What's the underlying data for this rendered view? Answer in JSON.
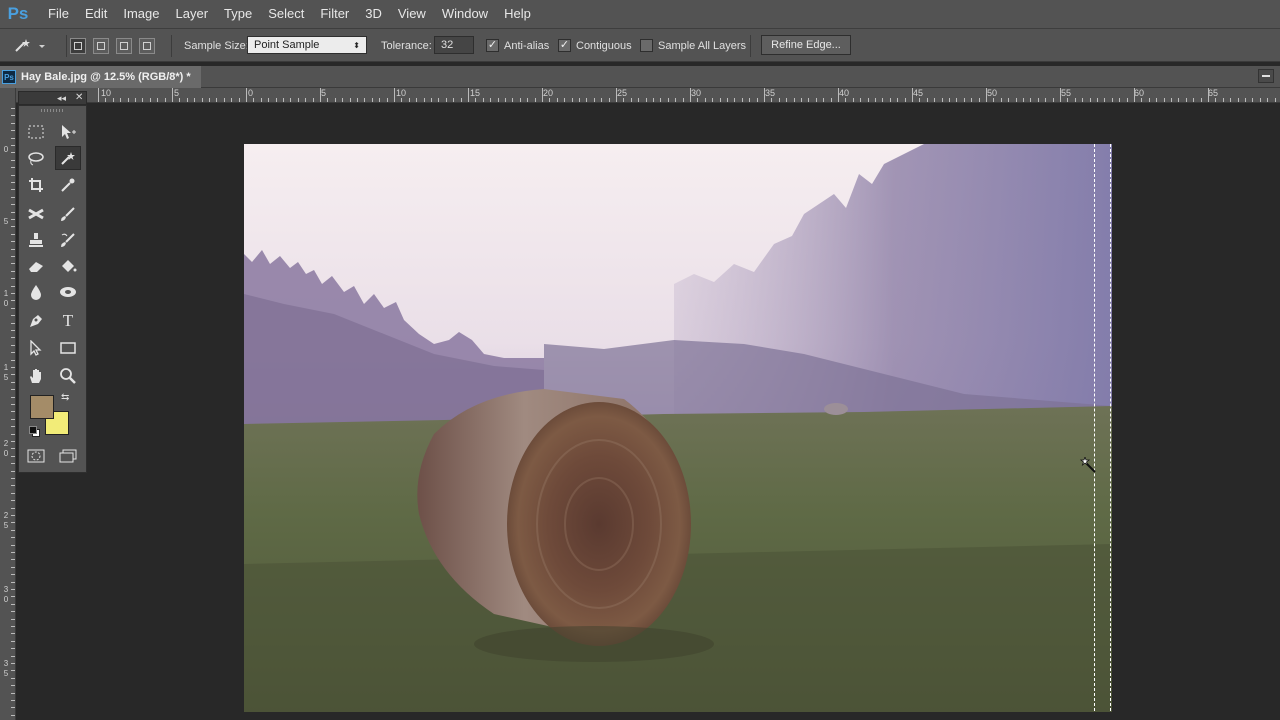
{
  "app": {
    "logo": "Ps"
  },
  "menu": [
    "File",
    "Edit",
    "Image",
    "Layer",
    "Type",
    "Select",
    "Filter",
    "3D",
    "View",
    "Window",
    "Help"
  ],
  "options_bar": {
    "tool_icon": "magic-wand-icon",
    "sample_size_label": "Sample Size:",
    "sample_size_value": "Point Sample",
    "tolerance_label": "Tolerance:",
    "tolerance_value": "32",
    "anti_alias": {
      "label": "Anti-alias",
      "checked": true
    },
    "contiguous": {
      "label": "Contiguous",
      "checked": true
    },
    "sample_all_layers": {
      "label": "Sample All Layers",
      "checked": false
    },
    "refine_edge": "Refine Edge..."
  },
  "document": {
    "tab_title": "Hay Bale.jpg @ 12.5% (RGB/8*) *",
    "ps_badge": "Ps"
  },
  "ruler_top": {
    "labels": [
      "10",
      "5",
      "0",
      "5",
      "10",
      "15",
      "20",
      "25",
      "30",
      "35",
      "40",
      "45",
      "50",
      "55",
      "60",
      "65"
    ],
    "origin_label": "0"
  },
  "ruler_left": {
    "labels": [
      "0",
      "5",
      "1",
      "0",
      "1",
      "5",
      "2",
      "0",
      "2",
      "5",
      "3",
      "0",
      "3",
      "5"
    ]
  },
  "toolbar": {
    "tools": [
      "rectangular-marquee-icon",
      "move-icon",
      "lasso-icon",
      "magic-wand-icon",
      "crop-icon",
      "eyedropper-icon",
      "healing-brush-icon",
      "brush-icon",
      "clone-stamp-icon",
      "history-brush-icon",
      "eraser-icon",
      "paint-bucket-icon",
      "blur-icon",
      "dodge-icon",
      "pen-icon",
      "type-icon",
      "path-selection-icon",
      "rectangle-icon",
      "hand-icon",
      "zoom-icon"
    ],
    "active_tool": "magic-wand-icon",
    "foreground_color": "#a48c68",
    "background_color": "#f2ec78"
  },
  "canvas": {
    "image": "hay-bale-photo"
  }
}
